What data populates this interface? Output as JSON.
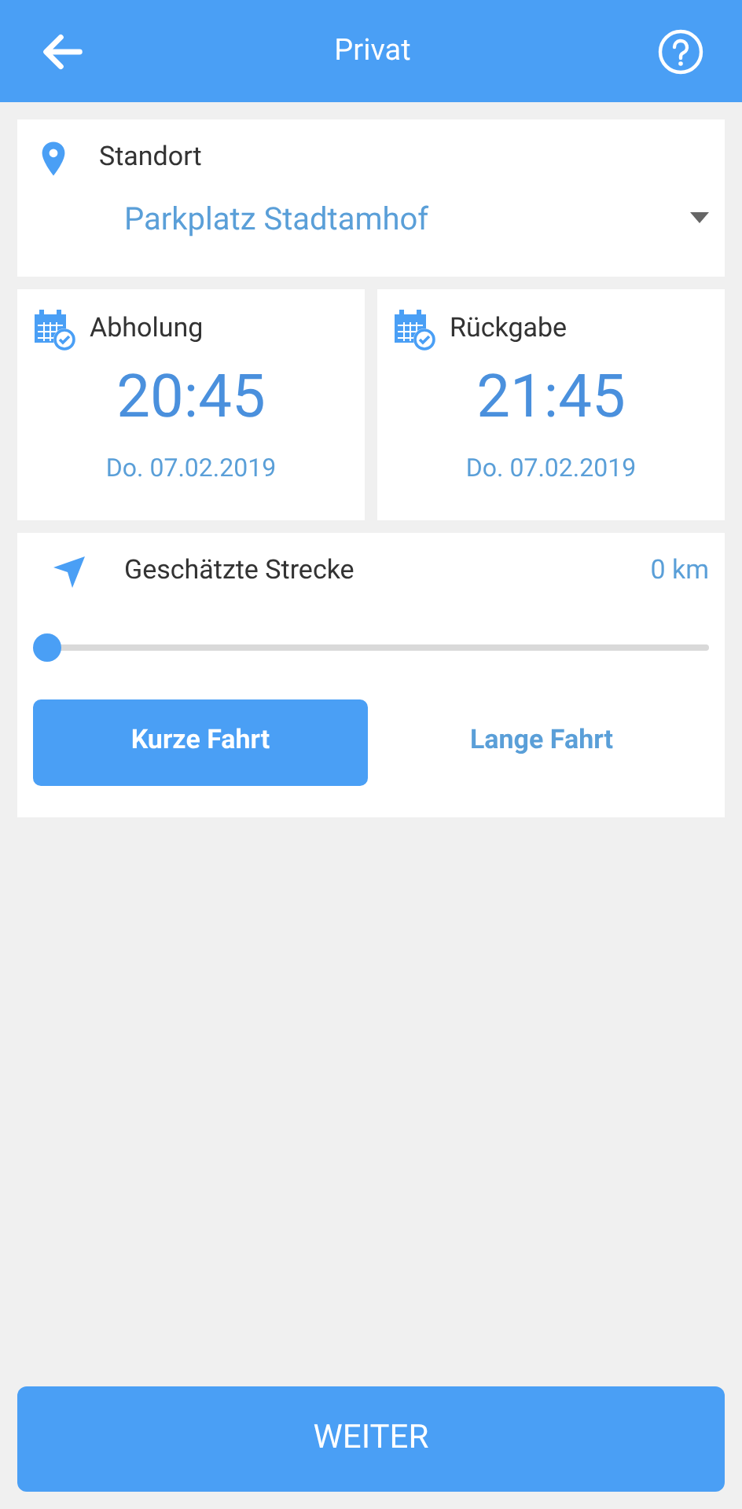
{
  "header": {
    "title": "Privat"
  },
  "location": {
    "label": "Standort",
    "value": "Parkplatz Stadtamhof"
  },
  "times": [
    {
      "label": "Abholung",
      "time": "20:45",
      "date": "Do. 07.02.2019"
    },
    {
      "label": "Rückgabe",
      "time": "21:45",
      "date": "Do. 07.02.2019"
    }
  ],
  "distance": {
    "label": "Geschätzte Strecke",
    "reading": "0 km",
    "level": 0
  },
  "trip_types": [
    {
      "label": "Kurze Fahrt",
      "selected": true
    },
    {
      "label": "Lange Fahrt",
      "selected": false
    }
  ],
  "next_button": {
    "label": "WEITER"
  }
}
